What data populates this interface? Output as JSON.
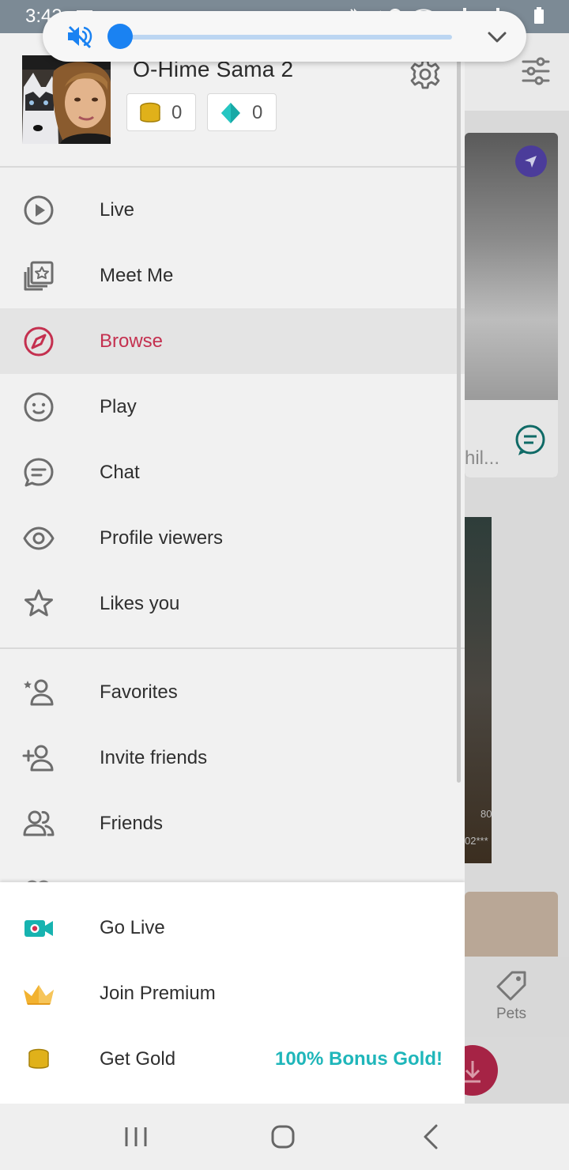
{
  "status_bar": {
    "time": "3:43"
  },
  "volume_panel": {
    "level_fraction": 0.0,
    "muted": true,
    "icons": [
      "volume-mute-icon",
      "chevron-down-icon"
    ]
  },
  "profile": {
    "name": "O-Hime Sama 2",
    "gold_count": "0",
    "diamond_count": "0"
  },
  "menu": {
    "items": [
      {
        "label": "Live",
        "icon": "play-circle-icon"
      },
      {
        "label": "Meet Me",
        "icon": "photo-stack-star-icon"
      },
      {
        "label": "Browse",
        "icon": "compass-icon"
      },
      {
        "label": "Play",
        "icon": "smiley-icon"
      },
      {
        "label": "Chat",
        "icon": "chat-bubble-icon"
      },
      {
        "label": "Profile viewers",
        "icon": "eye-icon"
      },
      {
        "label": "Likes you",
        "icon": "star-icon"
      }
    ],
    "secondary_items": [
      {
        "label": "Favorites",
        "icon": "user-star-icon"
      },
      {
        "label": "Invite friends",
        "icon": "user-plus-icon"
      },
      {
        "label": "Friends",
        "icon": "users-icon"
      }
    ],
    "active_item": "Browse"
  },
  "bottom_actions": {
    "go_live": "Go Live",
    "join_premium": "Join Premium",
    "get_gold": "Get Gold",
    "bonus": "100% Bonus Gold!"
  },
  "background": {
    "card_caption": "hil...",
    "card_text_1": "80",
    "card_text_2": "02***",
    "tab_label": "Pets"
  },
  "colors": {
    "accent_active": "#c4304f",
    "bonus_teal": "#1fb6ba",
    "volume_blue": "#1a82f2",
    "gold": "#e0b11a"
  }
}
